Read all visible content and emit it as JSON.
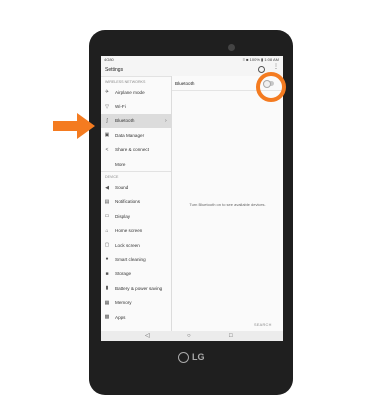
{
  "status": {
    "carrier": "4G80",
    "right": "≡ ■ 100% ▮ 1:08 AM"
  },
  "header": {
    "title": "Settings"
  },
  "sections": [
    {
      "label": "WIRELESS NETWORKS",
      "items": [
        {
          "label": "Airplane mode",
          "icon": "airplane-icon",
          "glyph": "✈"
        },
        {
          "label": "Wi-Fi",
          "icon": "wifi-icon",
          "glyph": "▽"
        },
        {
          "label": "Bluetooth",
          "icon": "bluetooth-icon",
          "glyph": "ʃ",
          "selected": true
        },
        {
          "label": "Data Manager",
          "icon": "data-manager-icon",
          "glyph": "▣"
        },
        {
          "label": "Share & connect",
          "icon": "share-icon",
          "glyph": "<"
        },
        {
          "label": "More",
          "icon": "",
          "glyph": ""
        }
      ]
    },
    {
      "label": "DEVICE",
      "items": [
        {
          "label": "Sound",
          "icon": "sound-icon",
          "glyph": "◀"
        },
        {
          "label": "Notifications",
          "icon": "notifications-icon",
          "glyph": "▤"
        },
        {
          "label": "Display",
          "icon": "display-icon",
          "glyph": "▭"
        },
        {
          "label": "Home screen",
          "icon": "home-screen-icon",
          "glyph": "⌂"
        },
        {
          "label": "Lock screen",
          "icon": "lock-icon",
          "glyph": "▢"
        },
        {
          "label": "Smart cleaning",
          "icon": "smart-cleaning-icon",
          "glyph": "●"
        },
        {
          "label": "Storage",
          "icon": "storage-icon",
          "glyph": "■"
        },
        {
          "label": "Battery & power saving",
          "icon": "battery-icon",
          "glyph": "▮"
        },
        {
          "label": "Memory",
          "icon": "memory-icon",
          "glyph": "▦"
        },
        {
          "label": "Apps",
          "icon": "apps-icon",
          "glyph": "▩"
        }
      ]
    }
  ],
  "detail": {
    "title": "Bluetooth",
    "message": "Turn Bluetooth on to see available devices.",
    "search_label": "SEARCH",
    "toggle_on": false
  },
  "brand": "LG",
  "accent": "#f47b20"
}
